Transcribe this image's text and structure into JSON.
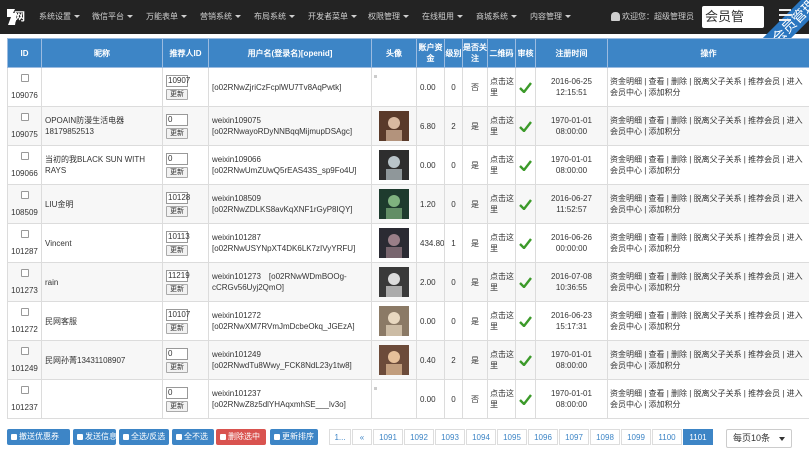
{
  "app": {
    "logo_text": "网",
    "welcome": "欢迎您：超级管理员",
    "member_button": "会员管",
    "ribbon": "会员管理"
  },
  "nav": [
    {
      "label": "系统设置"
    },
    {
      "label": "微信平台"
    },
    {
      "label": "万能表单"
    },
    {
      "label": "营销系统"
    },
    {
      "label": "布局系统"
    },
    {
      "label": "开发者菜单"
    },
    {
      "label": "权限管理"
    },
    {
      "label": "在线租用"
    },
    {
      "label": "商城系统"
    },
    {
      "label": "内容管理"
    }
  ],
  "table": {
    "headers": [
      "ID",
      "昵称",
      "推荐人ID",
      "用户名(登录名)[openid]",
      "头像",
      "账户资金",
      "级别",
      "是否关注",
      "二维码",
      "审核",
      "注册时间",
      "操作"
    ],
    "update_label": "更新",
    "qr_label": "点击这里",
    "ops_text": "资金明细 | 查看 | 删除 | 脱离父子关系 | 推荐会员 | 进入会员中心 | 添加积分",
    "rows": [
      {
        "id": "109076",
        "nick": "",
        "ref": "10907",
        "user1": "",
        "user2": "[o02RNwZjriCzFcplWU7Tv8AqPwtk]",
        "money": "0.00",
        "level": "0",
        "follow": "否",
        "time1": "2016-06-25",
        "time2": "12:15:51"
      },
      {
        "id": "109075",
        "nick": "OPOAIN防漫生活电器 18179852513",
        "ref": "0",
        "user1": "weixin109075",
        "user2": "[o02RNwayoRDyNNBqqMijmupDSAgc]",
        "money": "6.80",
        "level": "2",
        "follow": "是",
        "time1": "1970-01-01",
        "time2": "08:00:00"
      },
      {
        "id": "109066",
        "nick": "当初的我BLACK SUN WITH RAYS",
        "ref": "0",
        "user1": "weixin109066",
        "user2": "[o02RNwUmZUwQ5rEAS43S_sp9Fo4U]",
        "money": "0.00",
        "level": "0",
        "follow": "是",
        "time1": "1970-01-01",
        "time2": "08:00:00"
      },
      {
        "id": "108509",
        "nick": "LIU金明",
        "ref": "10128",
        "user1": "weixin108509",
        "user2": "[o02RNwZDLKS8avKqXNF1rGyP8IQY]",
        "money": "1.20",
        "level": "0",
        "follow": "是",
        "time1": "2016-06-27",
        "time2": "11:52:57"
      },
      {
        "id": "101287",
        "nick": "Vincent",
        "ref": "10113",
        "user1": "weixin101287",
        "user2": "[o02RNwUSYNpXT4DK6LK7zIVyYRFU]",
        "money": "434.80",
        "level": "1",
        "follow": "是",
        "time1": "2016-06-26",
        "time2": "00:00:00"
      },
      {
        "id": "101273",
        "nick": "rain",
        "ref": "11219",
        "user1": "weixin101273　[o02RNwWDmBOOg-",
        "user2": "cCRGv56Uyj2QmO]",
        "money": "2.00",
        "level": "0",
        "follow": "是",
        "time1": "2016-07-08",
        "time2": "10:36:55"
      },
      {
        "id": "101272",
        "nick": "民网客服",
        "ref": "10107",
        "user1": "weixin101272",
        "user2": "[o02RNwXM7RVmJmDcbeOkq_JGEzA]",
        "money": "0.00",
        "level": "0",
        "follow": "是",
        "time1": "2016-06-23",
        "time2": "15:17:31"
      },
      {
        "id": "101249",
        "nick": "民网孙菁13431108907",
        "ref": "0",
        "user1": "weixin101249",
        "user2": "[o02RNwdTu8Wwy_FCK8NdL23y1tw8]",
        "money": "0.40",
        "level": "2",
        "follow": "是",
        "time1": "1970-01-01",
        "time2": "08:00:00"
      },
      {
        "id": "101237",
        "nick": "",
        "ref": "0",
        "user1": "weixin101237",
        "user2": "[o02RNwZ8z5dlYHAqxmhSE___lv3o]",
        "money": "0.00",
        "level": "0",
        "follow": "否",
        "time1": "1970-01-01",
        "time2": "08:00:00"
      }
    ]
  },
  "bottom_buttons": [
    {
      "label": "撤送优惠券",
      "color": "#3d85c6"
    },
    {
      "label": "发送信息",
      "color": "#3d85c6"
    },
    {
      "label": "全选/反选",
      "color": "#3d85c6"
    },
    {
      "label": "全不选",
      "color": "#3d85c6"
    },
    {
      "label": "删除选中",
      "color": "#d9534f"
    },
    {
      "label": "更新排序",
      "color": "#3d85c6"
    }
  ],
  "pagination": [
    "1...",
    "«",
    "1091",
    "1092",
    "1093",
    "1094",
    "1095",
    "1096",
    "1097",
    "1098",
    "1099",
    "1100",
    "1101"
  ],
  "active_page": "1101",
  "per_page": "每页10条"
}
